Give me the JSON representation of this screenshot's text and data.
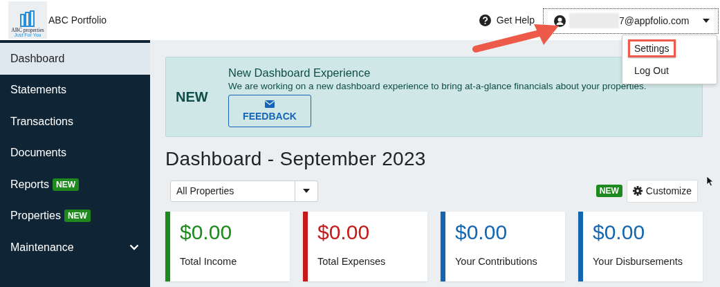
{
  "header": {
    "logo": {
      "name": "ABC properties",
      "tagline": "Just For You"
    },
    "title": "ABC Portfolio",
    "help": "Get Help",
    "account": {
      "email": "7@appfolio.com",
      "redacted": true,
      "focused": true
    }
  },
  "account_menu": {
    "items": [
      {
        "label": "Settings",
        "highlighted": true
      },
      {
        "label": "Log Out",
        "highlighted": false
      }
    ]
  },
  "annotation": {
    "arrow": true
  },
  "sidebar": {
    "items": [
      {
        "label": "Dashboard",
        "selected": true
      },
      {
        "label": "Statements",
        "selected": false
      },
      {
        "label": "Transactions",
        "selected": false
      },
      {
        "label": "Documents",
        "selected": false
      },
      {
        "label": "Reports",
        "selected": false,
        "badge": "NEW"
      },
      {
        "label": "Properties",
        "selected": false,
        "badge": "NEW"
      },
      {
        "label": "Maintenance",
        "selected": false,
        "expandable": true
      }
    ]
  },
  "banner": {
    "tag": "NEW",
    "title": "New Dashboard Experience",
    "text": "We are working on a new dashboard experience to bring at-a-glance financials about your properties.",
    "button": "FEEDBACK"
  },
  "heading": "Dashboard - September 2023",
  "toolbar": {
    "select": "All Properties",
    "badge": "NEW",
    "button": "Customize"
  },
  "cards": [
    {
      "amount": "$0.00",
      "label": "Total Income",
      "color": "#1e8a1e"
    },
    {
      "amount": "$0.00",
      "label": "Total Expenses",
      "color": "#c41a1a"
    },
    {
      "amount": "$0.00",
      "label": "Your Contributions",
      "color": "#1566b0"
    },
    {
      "amount": "$0.00",
      "label": "Your Disbursements",
      "color": "#1566b0"
    }
  ]
}
